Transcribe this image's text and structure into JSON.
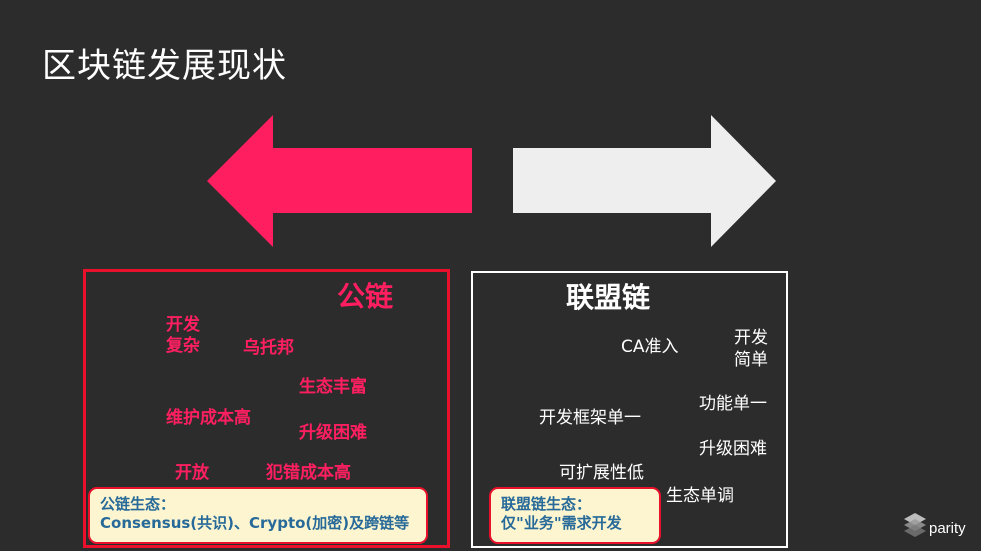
{
  "slide": {
    "title": "区块链发展现状"
  },
  "arrows": {
    "left_color": "#ff1f61",
    "right_color": "#eeeeee"
  },
  "public_chain": {
    "heading": "公链",
    "items": [
      "开发\n复杂",
      "乌托邦",
      "生态丰富",
      "维护成本高",
      "升级困难",
      "开放",
      "犯错成本高"
    ],
    "note_line1": "公链生态：",
    "note_line2": "Consensus(共识)、Crypto(加密)及跨链等"
  },
  "consortium_chain": {
    "heading": "联盟链",
    "items": [
      "CA准入",
      "开发\n简单",
      "开发框架单一",
      "功能单一",
      "升级困难",
      "可扩展性低",
      "生态单调"
    ],
    "note_line1": "联盟链生态：",
    "note_line2": "仅\"业务\"需求开发"
  },
  "logo": {
    "text": "parity",
    "icon": "parity-logo-icon"
  },
  "colors": {
    "background": "#2c2c2c",
    "accent_pink": "#ff1f61",
    "border_red": "#e8102b",
    "note_bg": "#fdf5cf",
    "note_text": "#276a99"
  }
}
